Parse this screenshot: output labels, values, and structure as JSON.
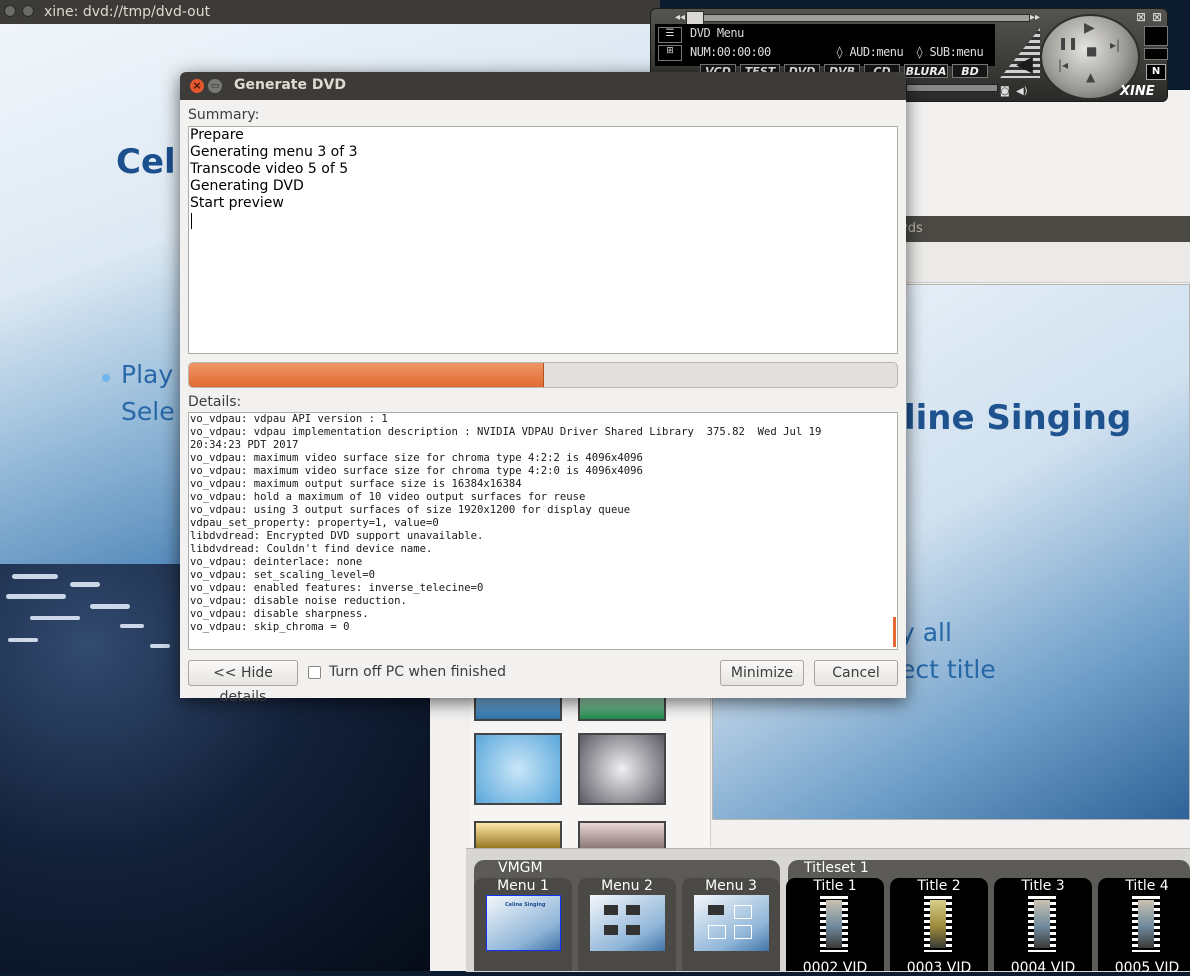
{
  "xine": {
    "window_title": "xine: dvd://tmp/dvd-out",
    "video": {
      "heading": "Cel",
      "line1": "Play",
      "line2": "Sele"
    }
  },
  "xine_panel": {
    "lcd_title": "DVD Menu",
    "lcd_time": "NUM:00:00:00",
    "lcd_audio": "◊ AUD:menu",
    "lcd_sub": "◊ SUB:menu",
    "buttons": [
      "VCD",
      "TEST",
      "DVD",
      "DVB",
      "CD",
      "BLURA",
      "BD"
    ],
    "logo": "XINE",
    "n_label": "N"
  },
  "author": {
    "topbar_text": "vds",
    "preview": {
      "title": "line Singing",
      "line1": "y all",
      "line2": "ect title"
    }
  },
  "strip": {
    "vmgm_label": "VMGM",
    "titleset_label": "Titleset 1",
    "menus": [
      {
        "label": "Menu 1"
      },
      {
        "label": "Menu 2"
      },
      {
        "label": "Menu 3"
      }
    ],
    "titles": [
      {
        "label": "Title 1",
        "sub": "0002 VID"
      },
      {
        "label": "Title 2",
        "sub": "0003 VID"
      },
      {
        "label": "Title 3",
        "sub": "0004 VID"
      },
      {
        "label": "Title 4",
        "sub": "0005 VID"
      }
    ],
    "menu1_thumb_text": "Celine Singing"
  },
  "dialog": {
    "title": "Generate DVD",
    "summary_label": "Summary:",
    "summary_lines": [
      "Prepare",
      "Generating menu 3 of 3",
      "Transcode video 5 of 5",
      "Generating DVD",
      "Start preview"
    ],
    "progress_fraction": 0.5,
    "details_label": "Details:",
    "details_lines": [
      "vo_vdpau: vdpau API version : 1",
      "vo_vdpau: vdpau implementation description : NVIDIA VDPAU Driver Shared Library  375.82  Wed Jul 19",
      "20:34:23 PDT 2017",
      "vo_vdpau: maximum video surface size for chroma type 4:2:2 is 4096x4096",
      "vo_vdpau: maximum video surface size for chroma type 4:2:0 is 4096x4096",
      "vo_vdpau: maximum output surface size is 16384x16384",
      "vo_vdpau: hold a maximum of 10 video output surfaces for reuse",
      "vo_vdpau: using 3 output surfaces of size 1920x1200 for display queue",
      "vdpau_set_property: property=1, value=0",
      "libdvdread: Encrypted DVD support unavailable.",
      "libdvdread: Couldn't find device name.",
      "vo_vdpau: deinterlace: none",
      "vo_vdpau: set_scaling_level=0",
      "vo_vdpau: enabled features: inverse_telecine=0",
      "vo_vdpau: disable noise reduction.",
      "vo_vdpau: disable sharpness.",
      "vo_vdpau: skip_chroma = 0"
    ],
    "hide_details": "<< Hide details",
    "turn_off": "Turn off PC when finished",
    "turn_off_checked": false,
    "minimize": "Minimize",
    "cancel": "Cancel",
    "close_glyph": "×",
    "min_glyph": "▭"
  },
  "colors": {
    "accent": "#e06a31",
    "titlebar": "#3c3b37",
    "dialog_bg": "#f2f1f0"
  }
}
